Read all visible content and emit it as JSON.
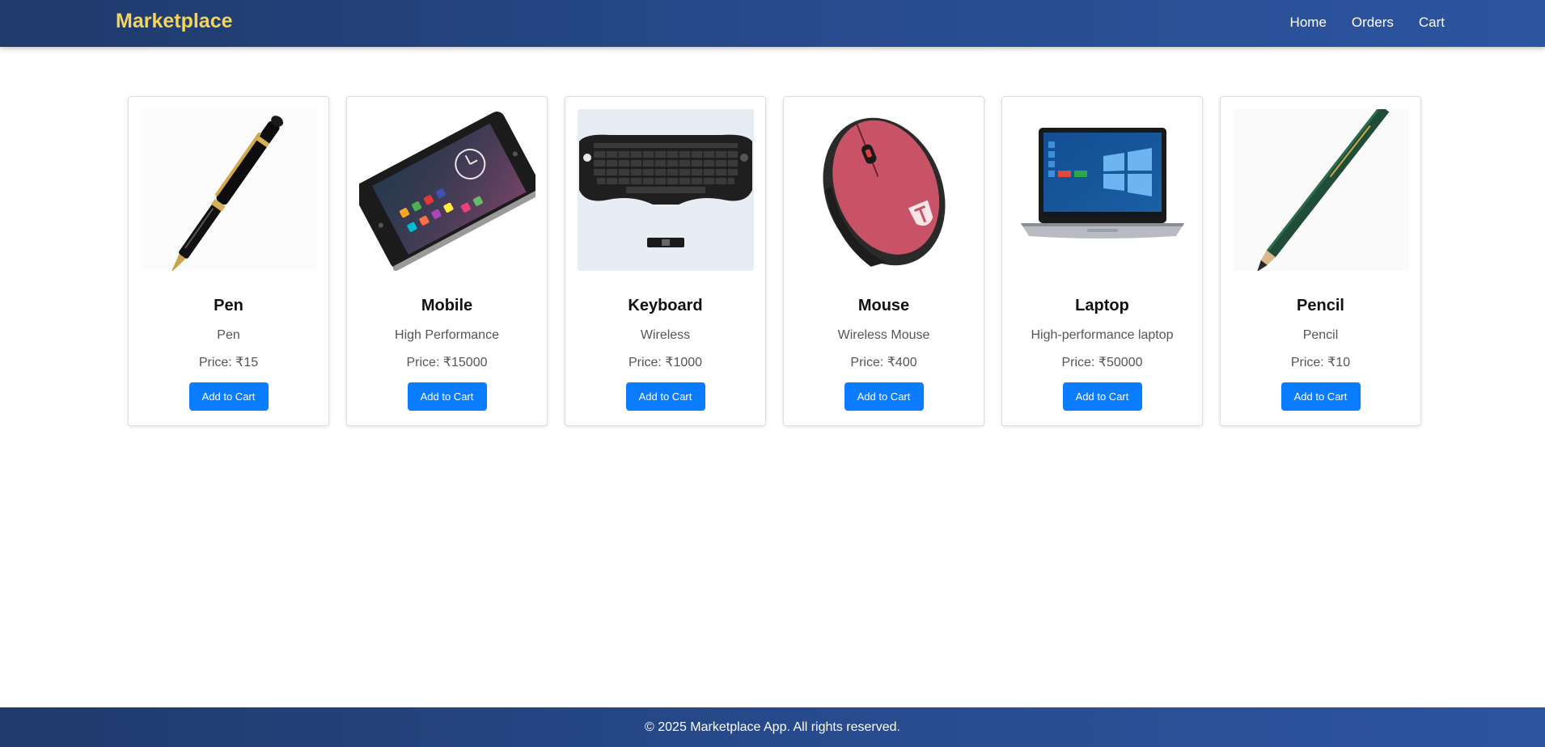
{
  "header": {
    "brand": "Marketplace",
    "nav": {
      "home": "Home",
      "orders": "Orders",
      "cart": "Cart"
    }
  },
  "products": [
    {
      "name": "Pen",
      "description": "Pen",
      "price": "Price: ₹15",
      "button": "Add to Cart",
      "icon": "pen-image"
    },
    {
      "name": "Mobile",
      "description": "High Performance",
      "price": "Price: ₹15000",
      "button": "Add to Cart",
      "icon": "mobile-phone-image"
    },
    {
      "name": "Keyboard",
      "description": "Wireless",
      "price": "Price: ₹1000",
      "button": "Add to Cart",
      "icon": "keyboard-image"
    },
    {
      "name": "Mouse",
      "description": "Wireless Mouse",
      "price": "Price: ₹400",
      "button": "Add to Cart",
      "icon": "mouse-image"
    },
    {
      "name": "Laptop",
      "description": "High-performance laptop",
      "price": "Price: ₹50000",
      "button": "Add to Cart",
      "icon": "laptop-image"
    },
    {
      "name": "Pencil",
      "description": "Pencil",
      "price": "Price: ₹10",
      "button": "Add to Cart",
      "icon": "pencil-image"
    }
  ],
  "footer": {
    "text": "© 2025 Marketplace App. All rights reserved."
  },
  "colors": {
    "brand": "#f5d45a",
    "header_bg": "#274a8c",
    "button": "#0a7cff"
  }
}
